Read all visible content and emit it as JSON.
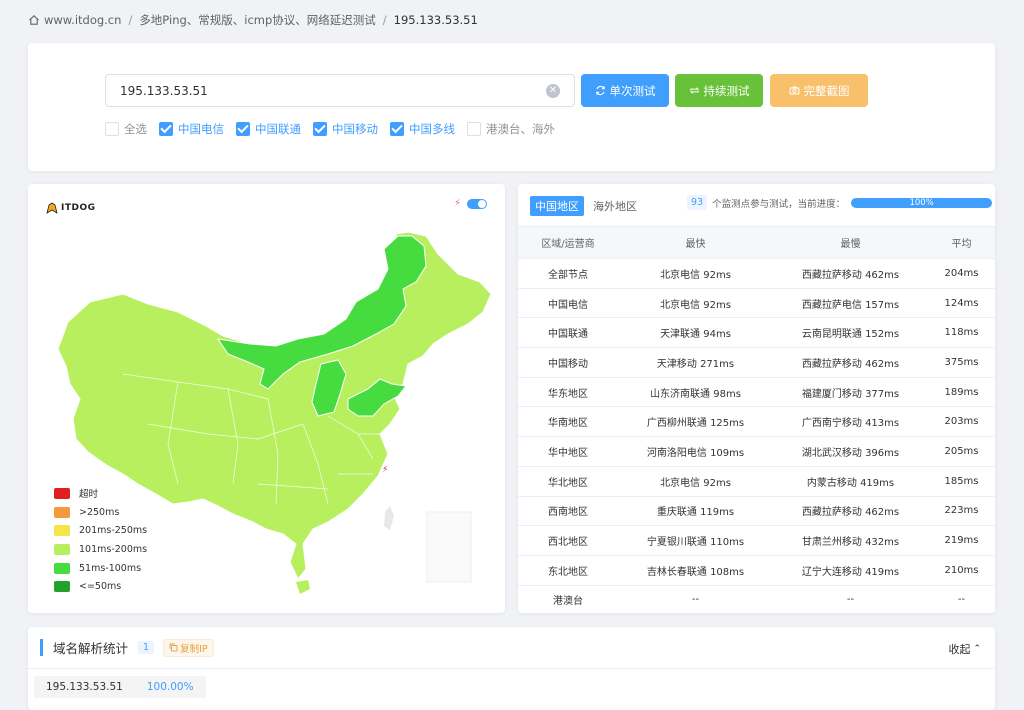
{
  "breadcrumb": {
    "home": "www.itdog.cn",
    "section": "多地Ping、常规版、icmp协议、网络延迟测试",
    "current": "195.133.53.51"
  },
  "search": {
    "value": "195.133.53.51",
    "buttons": {
      "once": "单次测试",
      "loop": "持续测试",
      "screenshot": "完整截图"
    },
    "checkboxes": [
      {
        "label": "全选",
        "checked": false
      },
      {
        "label": "中国电信",
        "checked": true
      },
      {
        "label": "中国联通",
        "checked": true
      },
      {
        "label": "中国移动",
        "checked": true
      },
      {
        "label": "中国多线",
        "checked": true
      },
      {
        "label": "港澳台、海外",
        "checked": false
      }
    ]
  },
  "map": {
    "logo_text": "ITDOG",
    "legend": [
      {
        "label": "超时",
        "color": "#e02020"
      },
      {
        "label": ">250ms",
        "color": "#f39a3b"
      },
      {
        "label": "201ms-250ms",
        "color": "#f5e44a"
      },
      {
        "label": "101ms-200ms",
        "color": "#b8ef5f"
      },
      {
        "label": "51ms-100ms",
        "color": "#46dc40"
      },
      {
        "label": "<=50ms",
        "color": "#22a12c"
      }
    ]
  },
  "stats": {
    "tabs": [
      "中国地区",
      "海外地区"
    ],
    "node_count": "93",
    "progress_text": "个监测点参与测试，当前进度：",
    "progress": "100%",
    "columns": [
      "区域/运营商",
      "最快",
      "最慢",
      "平均"
    ],
    "rows": [
      [
        "全部节点",
        "北京电信 92ms",
        "西藏拉萨移动 462ms",
        "204ms"
      ],
      [
        "中国电信",
        "北京电信 92ms",
        "西藏拉萨电信 157ms",
        "124ms"
      ],
      [
        "中国联通",
        "天津联通 94ms",
        "云南昆明联通 152ms",
        "118ms"
      ],
      [
        "中国移动",
        "天津移动 271ms",
        "西藏拉萨移动 462ms",
        "375ms"
      ],
      [
        "华东地区",
        "山东济南联通 98ms",
        "福建厦门移动 377ms",
        "189ms"
      ],
      [
        "华南地区",
        "广西柳州联通 125ms",
        "广西南宁移动 413ms",
        "203ms"
      ],
      [
        "华中地区",
        "河南洛阳电信 109ms",
        "湖北武汉移动 396ms",
        "205ms"
      ],
      [
        "华北地区",
        "北京电信 92ms",
        "内蒙古移动 419ms",
        "185ms"
      ],
      [
        "西南地区",
        "重庆联通 119ms",
        "西藏拉萨移动 462ms",
        "223ms"
      ],
      [
        "西北地区",
        "宁夏银川联通 110ms",
        "甘肃兰州移动 432ms",
        "219ms"
      ],
      [
        "东北地区",
        "吉林长春联通 108ms",
        "辽宁大连移动 419ms",
        "210ms"
      ],
      [
        "港澳台",
        "--",
        "--",
        "--"
      ]
    ]
  },
  "dns": {
    "title": "域名解析统计",
    "count": "1",
    "copy_label": "复制IP",
    "collapse_label": "收起",
    "ip": "195.133.53.51",
    "percent": "100.00%"
  }
}
